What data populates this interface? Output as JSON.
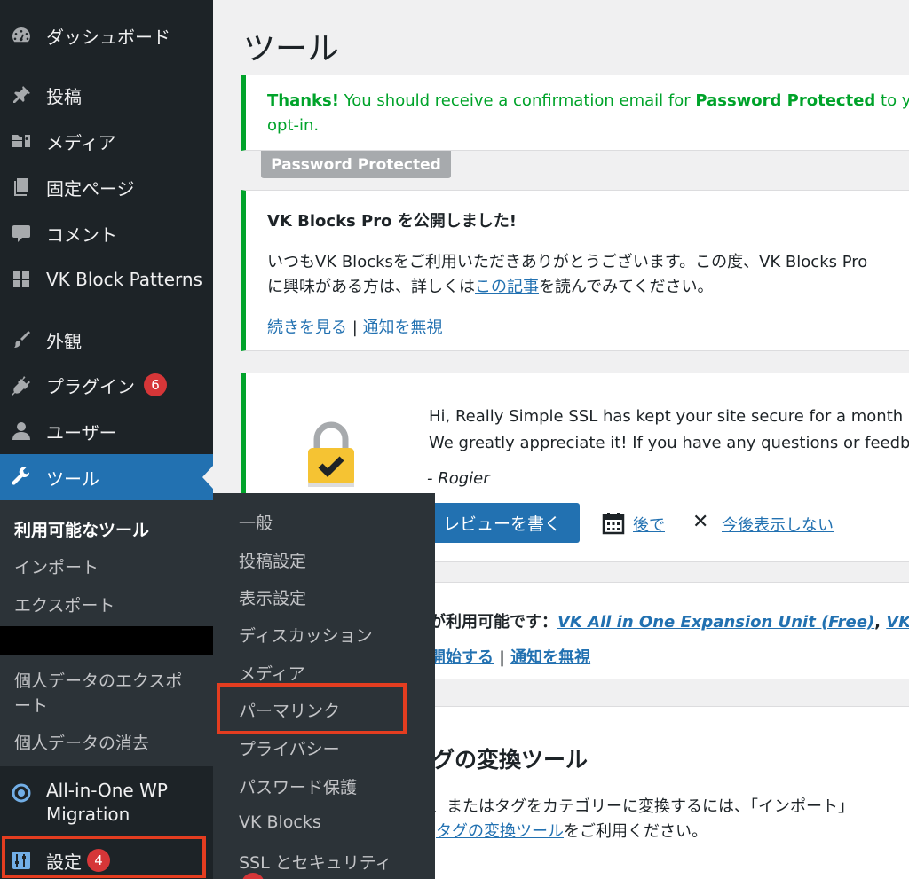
{
  "sidebar": {
    "items": [
      {
        "label": "ダッシュボード"
      },
      {
        "label": "投稿"
      },
      {
        "label": "メディア"
      },
      {
        "label": "固定ページ"
      },
      {
        "label": "コメント"
      },
      {
        "label": "VK Block Patterns"
      },
      {
        "label": "外観"
      },
      {
        "label": "プラグイン",
        "badge": "6"
      },
      {
        "label": "ユーザー"
      },
      {
        "label": "ツール"
      }
    ],
    "tools_submenu": [
      "利用可能なツール",
      "インポート",
      "エクスポート",
      "個人データのエクスポ",
      "ート",
      "個人データの消去"
    ],
    "aiowp_line1": "All-in-One WP",
    "aiowp_line2": "Migration",
    "settings": {
      "label": "設定",
      "badge": "4"
    }
  },
  "flyout": {
    "items": [
      "一般",
      "投稿設定",
      "表示設定",
      "ディスカッション",
      "メディア",
      "パーマリンク",
      "プライバシー",
      "パスワード保護",
      "VK Blocks",
      "SSL とセキュリティ"
    ]
  },
  "main": {
    "title": "ツール",
    "notice1": {
      "thanks": "Thanks!",
      "text_a": " You should receive a confirmation email for ",
      "bold": "Password Protected",
      "text_b": " to yo",
      "line2": "opt-in.",
      "tag": "Password Protected"
    },
    "notice2": {
      "title": "VK Blocks Pro を公開しました!",
      "line1": "いつもVK Blocksをご利用いただきありがとうございます。この度、VK Blocks Pro",
      "line2_a": "に興味がある方は、詳しくは",
      "line2_link": "この記事",
      "line2_b": "を読んでみてください。",
      "more_link": "続きを見る",
      "separator": " | ",
      "dismiss_link": "通知を無視"
    },
    "notice3": {
      "line1": "Hi, Really Simple SSL has kept your site secure for a month",
      "line2": "We greatly appreciate it! If you have any questions or feedb",
      "signature": "- Rogier",
      "review_button": "レビューを書く",
      "later_link": "後で",
      "never_link": "今後表示しない"
    },
    "notice4": {
      "text": "が利用可能です：",
      "link1": "VK All in One Expansion Unit (Free)",
      "sep": ", ",
      "link2": "VK",
      "start_link": "開始する",
      "separator": " | ",
      "dismiss_link": "通知を無視"
    },
    "converter": {
      "title": "グの変換ツール",
      "line1": "、またはタグをカテゴリーに変換するには、「インポート」",
      "line2_link": "タグの変換ツール",
      "line2_b": "をご利用ください。"
    }
  },
  "colors": {
    "sidebar_bg": "#1d2327",
    "submenu_bg": "#2c3338",
    "accent": "#2271b1",
    "success": "#00a32a",
    "badge": "#d63638",
    "highlight_box": "#e43d20"
  }
}
